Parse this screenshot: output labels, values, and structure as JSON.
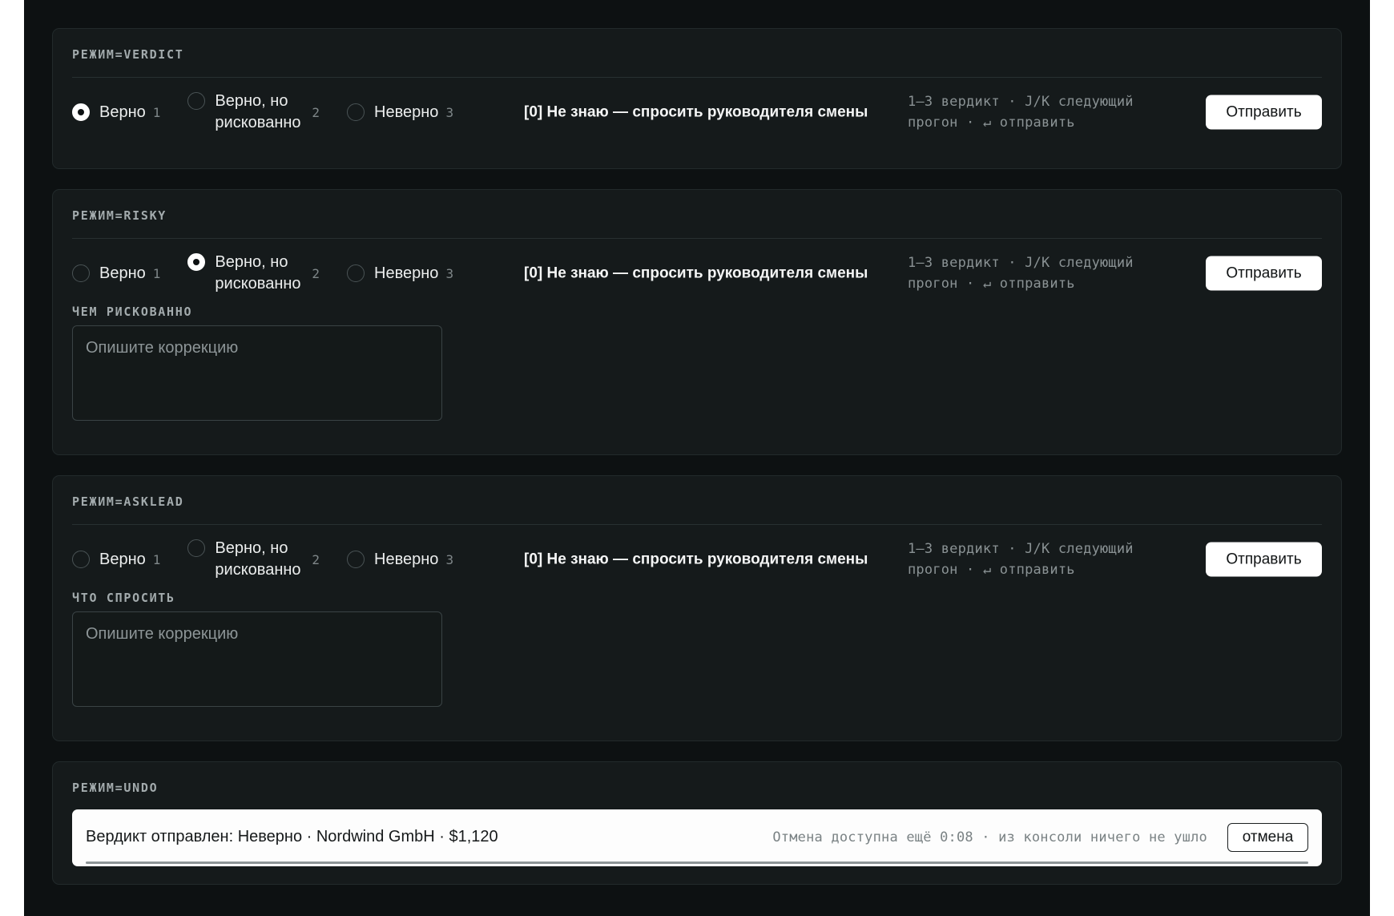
{
  "modes": [
    {
      "mode_label": "РЕЖИМ=VERDICT",
      "options": [
        {
          "label": "Верно",
          "key": "1",
          "checked": true
        },
        {
          "label": "Верно, но рискованно",
          "key": "2",
          "checked": false
        },
        {
          "label": "Неверно",
          "key": "3",
          "checked": false
        }
      ],
      "dont_know_label": "[0] Не знаю — спросить руководителя смены",
      "shortcut_hint": "1–3 вердикт · J/K следующий прогон · ↵ отправить",
      "submit_label": "Отправить"
    },
    {
      "mode_label": "РЕЖИМ=RISKY",
      "options": [
        {
          "label": "Верно",
          "key": "1",
          "checked": false
        },
        {
          "label": "Верно, но рискованно",
          "key": "2",
          "checked": true
        },
        {
          "label": "Неверно",
          "key": "3",
          "checked": false
        }
      ],
      "dont_know_label": "[0] Не знаю — спросить руководителя смены",
      "shortcut_hint": "1–3 вердикт · J/K следующий прогон · ↵ отправить",
      "submit_label": "Отправить",
      "field_label": "ЧЕМ РИСКОВАННО",
      "field_placeholder": "Опишите коррекцию",
      "field_value": ""
    },
    {
      "mode_label": "РЕЖИМ=ASKLEAD",
      "options": [
        {
          "label": "Верно",
          "key": "1",
          "checked": false
        },
        {
          "label": "Верно, но рискованно",
          "key": "2",
          "checked": false
        },
        {
          "label": "Неверно",
          "key": "3",
          "checked": false
        }
      ],
      "dont_know_label": "[0] Не знаю — спросить руководителя смены",
      "shortcut_hint": "1–3 вердикт · J/K следующий прогон · ↵ отправить",
      "submit_label": "Отправить",
      "field_label": "ЧТО СПРОСИТЬ",
      "field_placeholder": "Опишите коррекцию",
      "field_value": ""
    }
  ],
  "undo": {
    "mode_label": "РЕЖИМ=UNDO",
    "message": "Вердикт отправлен: Неверно · Nordwind GmbH · $1,120",
    "timer_text": "Отмена доступна ещё 0:08 · из консоли ничего не ушло",
    "undo_label": "отмена",
    "countdown_progress": 1
  },
  "colors": {
    "page_background": "#0d1112",
    "card_background": "#151a1b",
    "primary_button": "#ffffff",
    "muted_text": "#8a9294"
  }
}
